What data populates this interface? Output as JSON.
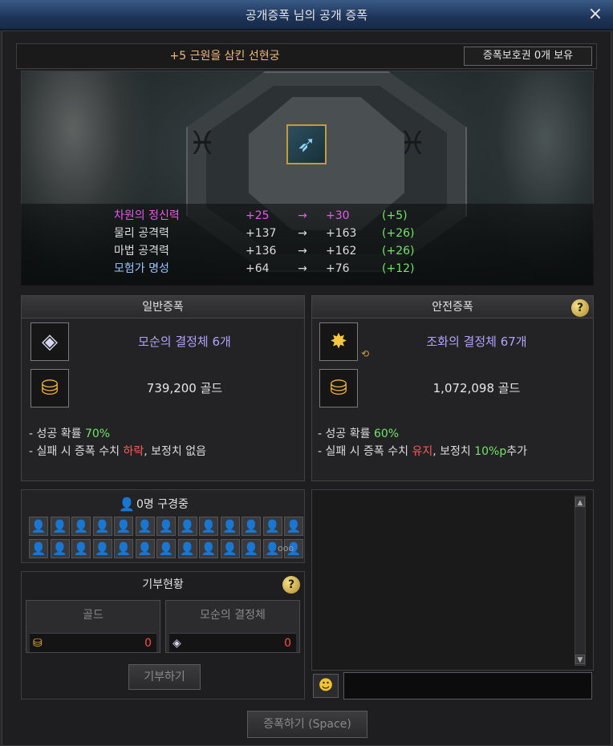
{
  "window": {
    "title": "공개증폭 님의 공개 증폭",
    "close_glyph": "×"
  },
  "item": {
    "name": "+5 근원을 삼킨 선현궁",
    "protect_tickets": "증폭보호권 0개 보유",
    "icon": "bow-weapon-icon"
  },
  "stats": [
    {
      "name": "차원의 정신력",
      "from": "+25",
      "arrow": "→",
      "to": "+30",
      "diff": "(+5)",
      "name_color": "#e35ce6",
      "value_color": "#e35ce6"
    },
    {
      "name": "물리 공격력",
      "from": "+137",
      "arrow": "→",
      "to": "+163",
      "diff": "(+26)",
      "name_color": "#dcdcdc",
      "value_color": "#dcdcdc"
    },
    {
      "name": "마법 공격력",
      "from": "+136",
      "arrow": "→",
      "to": "+162",
      "diff": "(+26)",
      "name_color": "#dcdcdc",
      "value_color": "#dcdcdc"
    },
    {
      "name": "모험가 명성",
      "from": "+64",
      "arrow": "→",
      "to": "+76",
      "diff": "(+12)",
      "name_color": "#9cc3ff",
      "value_color": "#dcdcdc"
    }
  ],
  "normal": {
    "title": "일반증폭",
    "material": "모순의 결정체 6개",
    "material_icon": "crystal-icon",
    "gold": "739,200 골드",
    "gold_icon": "gold-coins-icon",
    "line1_prefix": "- 성공 확률 ",
    "line1_value": "70%",
    "line2_prefix": "- 실패 시 증폭 수치 ",
    "line2_value": "하락",
    "line2_suffix": ", 보정치 없음"
  },
  "safe": {
    "title": "안전증폭",
    "help": "?",
    "material": "조화의 결정체 67개",
    "material_icon": "star-crystal-icon",
    "swap_icon": "swap-icon",
    "gold": "1,072,098 골드",
    "gold_icon": "gold-coins-icon",
    "line1_prefix": "- 성공 확률 ",
    "line1_value": "60%",
    "line2_prefix": "- 실패 시 증폭 수치 ",
    "line2_value": "유지",
    "line2_mid": ", 보정치 ",
    "line2_bonus": "10%p",
    "line2_suffix": "추가"
  },
  "party": {
    "watching": "0명 구경중",
    "more": "ooo",
    "seats": 26
  },
  "donation": {
    "title": "기부현황",
    "help": "?",
    "gold_label": "골드",
    "gold_value": "0",
    "crystal_label": "모순의 결정체",
    "crystal_value": "0",
    "donate_button": "기부하기"
  },
  "chat": {
    "input_value": "",
    "emoji_icon": "smiley-face-icon"
  },
  "footer": {
    "upgrade_button": "증폭하기 (Space)"
  },
  "colors": {
    "accent_gold": "#f0b87a",
    "success_green": "#74e36a",
    "fail_red": "#ff5a5a",
    "purple_text": "#b3a2ff"
  }
}
